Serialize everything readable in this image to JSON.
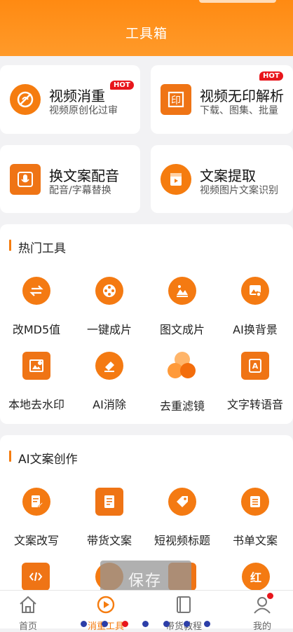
{
  "header": {
    "title": "工具箱"
  },
  "features": [
    {
      "title": "视频消重",
      "sub": "视频原创化过审",
      "badge": "HOT",
      "icon": "no-copy-icon"
    },
    {
      "title": "视频无印解析",
      "sub": "下载、图集、批量",
      "badge": "HOT",
      "icon": "seal-icon"
    },
    {
      "title": "换文案配音",
      "sub": "配音/字幕替换",
      "icon": "microphone-icon"
    },
    {
      "title": "文案提取",
      "sub": "视频图片文案识别",
      "icon": "play-doc-icon"
    }
  ],
  "hot_tools": {
    "title": "热门工具",
    "items": [
      {
        "label": "改MD5值",
        "icon": "swap-icon"
      },
      {
        "label": "一键成片",
        "icon": "film-reel-icon"
      },
      {
        "label": "图文成片",
        "icon": "image-text-icon"
      },
      {
        "label": "AI换背景",
        "icon": "image-replace-icon"
      },
      {
        "label": "本地去水印",
        "icon": "remove-watermark-icon"
      },
      {
        "label": "AI消除",
        "icon": "eraser-icon"
      },
      {
        "label": "去重滤镜",
        "icon": "filter-icon"
      },
      {
        "label": "文字转语音",
        "icon": "text-to-speech-icon"
      }
    ]
  },
  "ai_tools": {
    "title": "AI文案创作",
    "items": [
      {
        "label": "文案改写",
        "icon": "doc-edit-icon"
      },
      {
        "label": "带货文案",
        "icon": "doc-icon"
      },
      {
        "label": "短视频标题",
        "icon": "tag-icon"
      },
      {
        "label": "书单文案",
        "icon": "list-icon"
      }
    ],
    "partial_icons": [
      "code-icon",
      "doc-settings-icon",
      "doc-folder-icon",
      "red-text-icon"
    ],
    "partial_red_label": "红"
  },
  "overlay": {
    "save_label": "保存"
  },
  "tabbar": [
    {
      "label": "首页",
      "icon": "home-icon"
    },
    {
      "label": "消重工具",
      "icon": "play-circle-icon",
      "active": true
    },
    {
      "label": "带货教程",
      "icon": "book-icon"
    },
    {
      "label": "我的",
      "icon": "user-icon"
    }
  ],
  "colors": {
    "accent": "#f57c0f",
    "hot": "#e8161c",
    "pager_dot": "#2c3ea8"
  }
}
